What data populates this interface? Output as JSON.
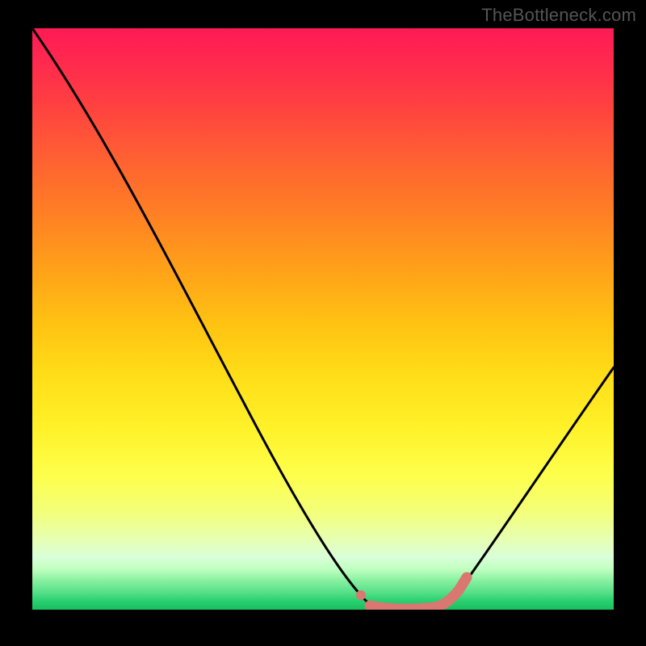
{
  "watermark": "TheBottleneck.com",
  "chart_data": {
    "type": "line",
    "title": "",
    "xlabel": "",
    "ylabel": "",
    "xlim": [
      0,
      100
    ],
    "ylim": [
      0,
      100
    ],
    "series": [
      {
        "name": "bottleneck-curve",
        "x": [
          0,
          10,
          20,
          30,
          40,
          50,
          55,
          57,
          62,
          68,
          72,
          80,
          90,
          100
        ],
        "y": [
          100,
          83,
          66,
          49,
          31,
          14,
          5,
          2,
          0,
          0,
          2,
          10,
          25,
          42
        ]
      }
    ],
    "highlight": {
      "name": "optimal-range",
      "x_start": 57,
      "x_end": 72,
      "color": "#d97770"
    },
    "background_gradient": {
      "top": "#ff1a55",
      "mid": "#ffe020",
      "bottom": "#1ac060"
    }
  }
}
